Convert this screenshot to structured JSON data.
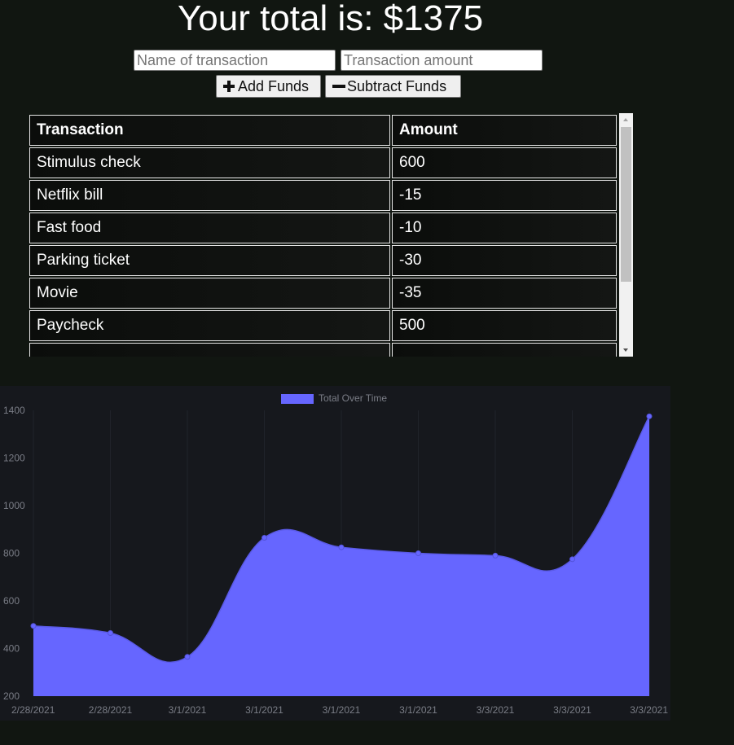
{
  "header": {
    "total_text": "Your total is: $1375"
  },
  "form": {
    "name_placeholder": "Name of transaction",
    "amount_placeholder": "Transaction amount",
    "add_label": "Add Funds",
    "subtract_label": "Subtract Funds"
  },
  "table": {
    "headers": [
      "Transaction",
      "Amount"
    ],
    "rows": [
      {
        "name": "Stimulus check",
        "amount": "600"
      },
      {
        "name": "Netflix bill",
        "amount": "-15"
      },
      {
        "name": "Fast food",
        "amount": "-10"
      },
      {
        "name": "Parking ticket",
        "amount": "-30"
      },
      {
        "name": "Movie",
        "amount": "-35"
      },
      {
        "name": "Paycheck",
        "amount": "500"
      }
    ]
  },
  "chart_data": {
    "type": "area",
    "legend": "Total Over Time",
    "color": "#6666ff",
    "categories": [
      "2/28/2021",
      "2/28/2021",
      "3/1/2021",
      "3/1/2021",
      "3/1/2021",
      "3/1/2021",
      "3/3/2021",
      "3/3/2021",
      "3/3/2021"
    ],
    "values": [
      495,
      465,
      365,
      865,
      825,
      800,
      790,
      775,
      1375
    ],
    "yticks": [
      200,
      400,
      600,
      800,
      1000,
      1200,
      1400
    ],
    "ylim": [
      200,
      1400
    ],
    "grid": true,
    "legend_position": "top"
  }
}
